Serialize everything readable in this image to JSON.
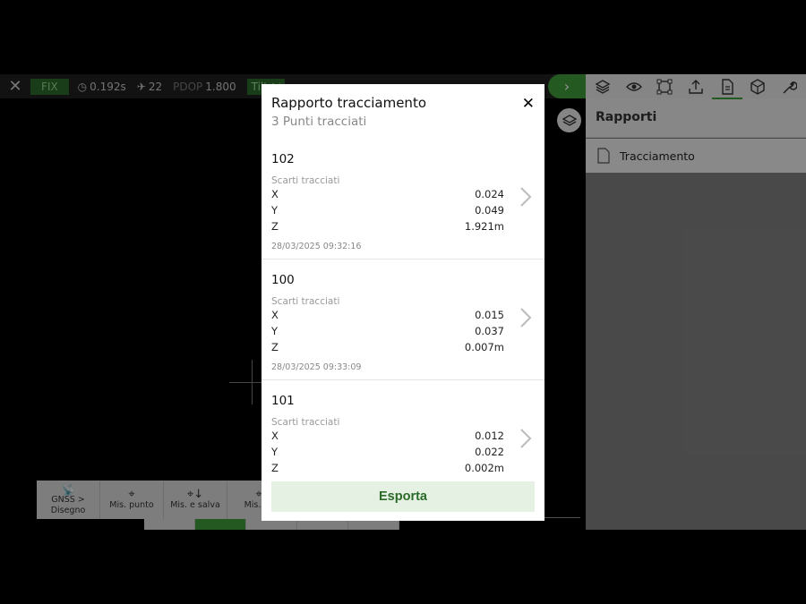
{
  "topbar": {
    "fix": "FIX",
    "age": "0.192s",
    "satellites": "22",
    "pdop_label": "PDOP",
    "pdop_value": "1.800",
    "tilt": "Tilt"
  },
  "bottombar": {
    "items": [
      {
        "label": "GNSS > Disegno"
      },
      {
        "label": "Mis. punto"
      },
      {
        "label": "Mis. e salva"
      },
      {
        "label": "Mis. co"
      }
    ]
  },
  "right_panel": {
    "header": "Rapporti",
    "items": [
      {
        "label": "Tracciamento"
      }
    ]
  },
  "modal": {
    "title": "Rapporto tracciamento",
    "subtitle": "3 Punti tracciati",
    "records": [
      {
        "name": "102",
        "deviation_label": "Scarti tracciati",
        "x_label": "X",
        "x": "0.024",
        "y_label": "Y",
        "y": "0.049",
        "z_label": "Z",
        "z": "1.921m",
        "date": "28/03/2025 09:32:16"
      },
      {
        "name": "100",
        "deviation_label": "Scarti tracciati",
        "x_label": "X",
        "x": "0.015",
        "y_label": "Y",
        "y": "0.037",
        "z_label": "Z",
        "z": "0.007m",
        "date": "28/03/2025 09:33:09"
      },
      {
        "name": "101",
        "deviation_label": "Scarti tracciati",
        "x_label": "X",
        "x": "0.012",
        "y_label": "Y",
        "y": "0.022",
        "z_label": "Z",
        "z": "0.002m",
        "date": ""
      }
    ],
    "export_label": "Esporta"
  },
  "colors": {
    "accent": "#3e9b3a",
    "export_bg": "#e4f1e3",
    "export_text": "#2b6a28"
  }
}
